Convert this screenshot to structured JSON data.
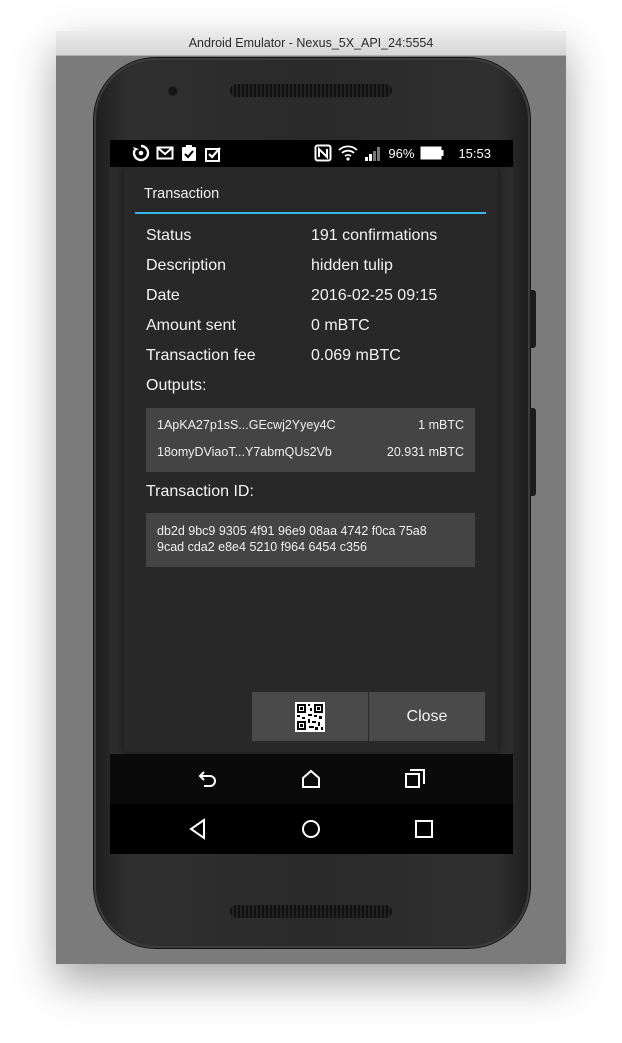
{
  "window": {
    "title": "Android Emulator - Nexus_5X_API_24:5554"
  },
  "statusbar": {
    "battery": "96%",
    "time": "15:53"
  },
  "dialog": {
    "title": "Transaction",
    "rows": [
      {
        "label": "Status",
        "value": "191 confirmations"
      },
      {
        "label": "Description",
        "value": "hidden tulip"
      },
      {
        "label": "Date",
        "value": "2016-02-25 09:15"
      },
      {
        "label": "Amount sent",
        "value": "0 mBTC"
      },
      {
        "label": "Transaction fee",
        "value": "0.069 mBTC"
      }
    ],
    "outputs_label": "Outputs:",
    "outputs": [
      {
        "address": "1ApKA27p1sS...GEcwj2Yyey4C",
        "amount": "1 mBTC"
      },
      {
        "address": "18omyDViaoT...Y7abmQUs2Vb",
        "amount": "20.931 mBTC"
      }
    ],
    "txid_label": "Transaction ID:",
    "txid_line1": "db2d 9bc9 9305 4f91 96e9 08aa 4742 f0ca 75a8",
    "txid_line2": "9cad cda2 e8e4 5210 f964 6454 c356",
    "qr_icon": "qr-code-icon",
    "close_label": "Close"
  },
  "accent_color": "#33b5e5"
}
